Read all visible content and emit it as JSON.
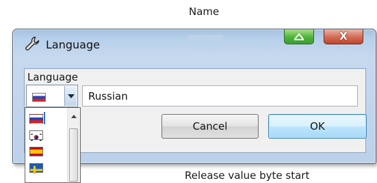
{
  "background": {
    "column_header": "Name",
    "row_label": "Release value byte start"
  },
  "dialog": {
    "title": "Language",
    "title_icon": "wrench-icon",
    "minimize_icon": "minimize-icon",
    "close_glyph": "X"
  },
  "form": {
    "label": "Language",
    "selected_flag": "russia-flag-icon",
    "language_name": "Russian",
    "cancel_label": "Cancel",
    "ok_label": "OK"
  },
  "dropdown": {
    "flags": [
      "russia-flag-icon",
      "south-korea-flag-icon",
      "spain-flag-icon",
      "sweden-flag-icon"
    ]
  },
  "colors": {
    "ok_border": "#3c7fb1",
    "close_button": "#c3442a",
    "minimize_button": "#4fb33c"
  }
}
